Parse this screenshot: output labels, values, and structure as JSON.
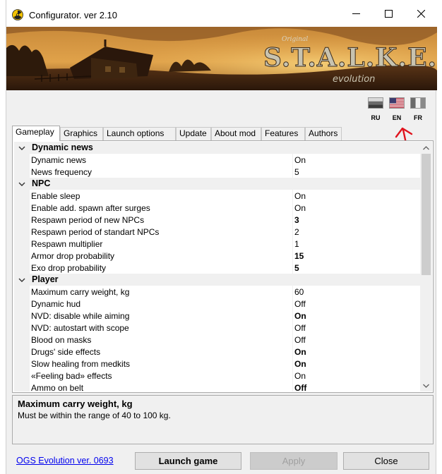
{
  "window": {
    "title": "Configurator. ver 2.10"
  },
  "banner": {
    "logo_top": "Original",
    "logo_main": "S.T.A.L.K.E.R.",
    "logo_sub": "evolution"
  },
  "languages": [
    {
      "code": "RU"
    },
    {
      "code": "EN"
    },
    {
      "code": "FR"
    }
  ],
  "tabs": [
    {
      "label": "Gameplay",
      "active": true
    },
    {
      "label": "Graphics"
    },
    {
      "label": "Launch options"
    },
    {
      "label": "Update"
    },
    {
      "label": "About mod"
    },
    {
      "label": "Features"
    },
    {
      "label": "Authors"
    }
  ],
  "properties": {
    "categories": [
      {
        "name": "Dynamic news",
        "items": [
          {
            "name": "Dynamic news",
            "value": "On",
            "bold": false
          },
          {
            "name": "News frequency",
            "value": "5",
            "bold": false
          }
        ]
      },
      {
        "name": "NPC",
        "items": [
          {
            "name": "Enable sleep",
            "value": "On",
            "bold": false
          },
          {
            "name": "Enable add. spawn after surges",
            "value": "On",
            "bold": false
          },
          {
            "name": "Respawn period of new NPCs",
            "value": "3",
            "bold": true
          },
          {
            "name": "Respawn period of standart NPCs",
            "value": "2",
            "bold": false
          },
          {
            "name": "Respawn multiplier",
            "value": "1",
            "bold": false
          },
          {
            "name": "Armor drop probability",
            "value": "15",
            "bold": true
          },
          {
            "name": "Exo drop probability",
            "value": "5",
            "bold": true
          }
        ]
      },
      {
        "name": "Player",
        "items": [
          {
            "name": "Maximum carry weight, kg",
            "value": "60",
            "bold": false
          },
          {
            "name": "Dynamic hud",
            "value": "Off",
            "bold": false
          },
          {
            "name": "NVD: disable while aiming",
            "value": "On",
            "bold": true
          },
          {
            "name": "NVD: autostart with scope",
            "value": "Off",
            "bold": false
          },
          {
            "name": "Blood on masks",
            "value": "Off",
            "bold": false
          },
          {
            "name": "Drugs' side effects",
            "value": "On",
            "bold": true
          },
          {
            "name": "Slow healing from medkits",
            "value": "On",
            "bold": true
          },
          {
            "name": "«Feeling bad» effects",
            "value": "On",
            "bold": false
          },
          {
            "name": "Ammo on belt",
            "value": "Off",
            "bold": true
          }
        ]
      }
    ]
  },
  "description": {
    "title": "Maximum carry weight, kg",
    "text": "Must be within the range of 40 to 100 kg."
  },
  "footer": {
    "version_link": "OGS Evolution ver. 0693",
    "launch_label": "Launch game",
    "apply_label": "Apply",
    "close_label": "Close"
  },
  "colors": {
    "annotation_arrow": "#e0141e",
    "link": "#0000ee",
    "panel_bg": "#f0f0f0"
  }
}
